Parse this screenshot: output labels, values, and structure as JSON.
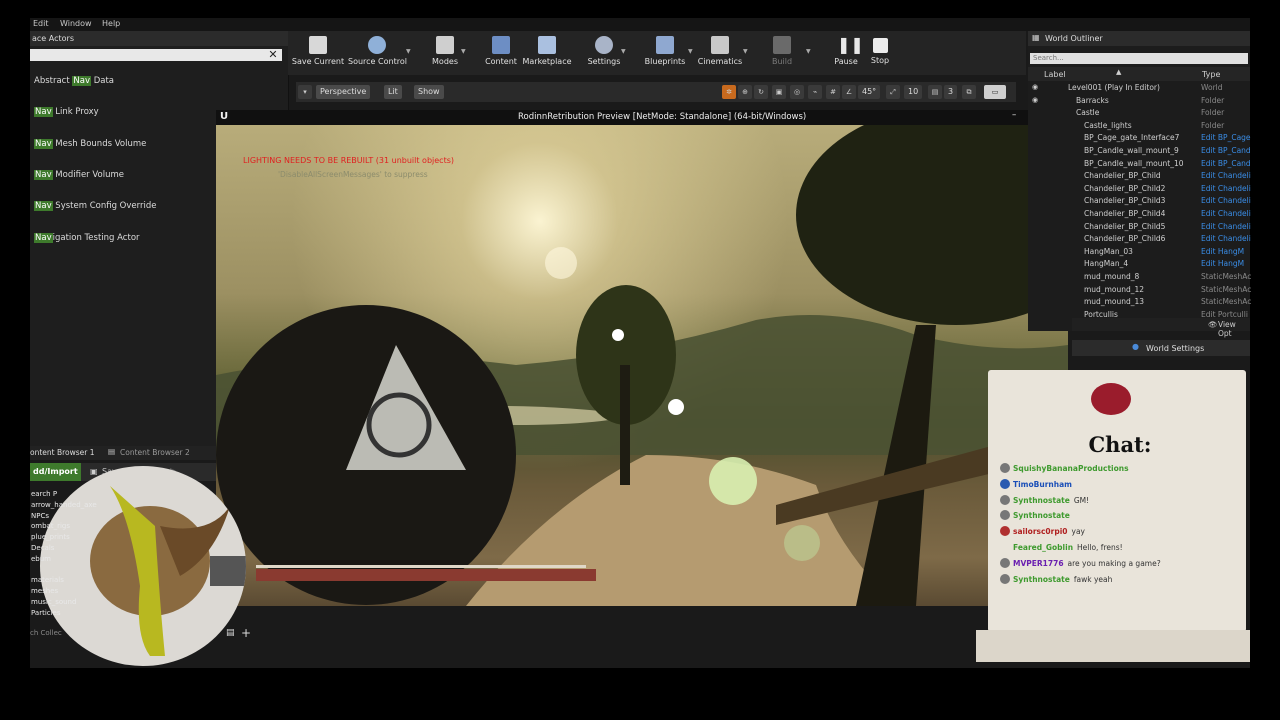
{
  "menu": {
    "edit": "Edit",
    "window": "Window",
    "help": "Help"
  },
  "left_panel": {
    "tab_label": "ace Actors",
    "items": [
      {
        "hl": "",
        "pre": "Abstract ",
        "mark": "Nav",
        "post": " Data"
      },
      {
        "pre": "",
        "mark": "Nav",
        "post": " Link Proxy"
      },
      {
        "pre": "",
        "mark": "Nav",
        "post": " Mesh Bounds Volume"
      },
      {
        "pre": "",
        "mark": "Nav",
        "post": " Modifier Volume"
      },
      {
        "pre": "",
        "mark": "Nav",
        "post": " System Config Override"
      },
      {
        "pre": "",
        "mark": "Nav",
        "post": "igation Testing Actor"
      }
    ]
  },
  "toolbar": {
    "save_current": "Save Current",
    "source_control": "Source Control",
    "modes": "Modes",
    "content": "Content",
    "marketplace": "Marketplace",
    "settings": "Settings",
    "blueprints": "Blueprints",
    "cinematics": "Cinematics",
    "build": "Build",
    "pause": "Pause",
    "stop": "Stop"
  },
  "viewport_bar": {
    "perspective": "Perspective",
    "lit": "Lit",
    "show": "Show",
    "angle": "45°",
    "grid": "10",
    "cam": "3"
  },
  "game": {
    "title": "RodinnRetribution Preview [NetMode: Standalone] (64-bit/Windows)",
    "warning": "LIGHTING NEEDS TO BE REBUILT (31 unbuilt objects)",
    "suppress": "'DisableAllScreenMessages' to suppress"
  },
  "outliner": {
    "tab": "World Outliner",
    "search_placeholder": "Search...",
    "col_label": "Label",
    "col_type": "Type",
    "rows": [
      {
        "label": "Level001 (Play In Editor)",
        "type": "World",
        "indent": 40,
        "kind": "gray"
      },
      {
        "label": "Barracks",
        "type": "Folder",
        "indent": 48,
        "kind": "gray"
      },
      {
        "label": "Castle",
        "type": "Folder",
        "indent": 48,
        "kind": "gray"
      },
      {
        "label": "Castle_lights",
        "type": "Folder",
        "indent": 56,
        "kind": "gray"
      },
      {
        "label": "BP_Cage_gate_Interface7",
        "type": "Edit BP_Cage",
        "indent": 56,
        "kind": "edit"
      },
      {
        "label": "BP_Candle_wall_mount_9",
        "type": "Edit BP_Cand",
        "indent": 56,
        "kind": "edit"
      },
      {
        "label": "BP_Candle_wall_mount_10",
        "type": "Edit BP_Cand",
        "indent": 56,
        "kind": "edit"
      },
      {
        "label": "Chandelier_BP_Child",
        "type": "Edit Chandeli",
        "indent": 56,
        "kind": "edit"
      },
      {
        "label": "Chandelier_BP_Child2",
        "type": "Edit Chandeli",
        "indent": 56,
        "kind": "edit"
      },
      {
        "label": "Chandelier_BP_Child3",
        "type": "Edit Chandeli",
        "indent": 56,
        "kind": "edit"
      },
      {
        "label": "Chandelier_BP_Child4",
        "type": "Edit Chandeli",
        "indent": 56,
        "kind": "edit"
      },
      {
        "label": "Chandelier_BP_Child5",
        "type": "Edit Chandeli",
        "indent": 56,
        "kind": "edit"
      },
      {
        "label": "Chandelier_BP_Child6",
        "type": "Edit Chandeli",
        "indent": 56,
        "kind": "edit"
      },
      {
        "label": "HangMan_03",
        "type": "Edit HangM",
        "indent": 56,
        "kind": "edit"
      },
      {
        "label": "HangMan_4",
        "type": "Edit HangM",
        "indent": 56,
        "kind": "edit"
      },
      {
        "label": "mud_mound_8",
        "type": "StaticMeshAc",
        "indent": 56,
        "kind": "gray"
      },
      {
        "label": "mud_mound_12",
        "type": "StaticMeshAc",
        "indent": 56,
        "kind": "gray"
      },
      {
        "label": "mud_mound_13",
        "type": "StaticMeshAc",
        "indent": 56,
        "kind": "gray"
      },
      {
        "label": "Portcullis",
        "type": "Edit Portculli",
        "indent": 56,
        "kind": "gray"
      }
    ],
    "view_options": "View Opt",
    "world_settings": "World Settings"
  },
  "content_browser": {
    "tab1": "ontent Browser 1",
    "tab2": "Content Browser 2",
    "add_import": "dd/Import",
    "save_all": "Save All",
    "folders": [
      "earch P",
      "arrow_handed_axe",
      "NPCs",
      "ombat_rigs",
      "plue_prints",
      "Decals",
      "ebum",
      "",
      "materials",
      "meshes",
      "music_sound",
      "Particles"
    ],
    "collections": "ch Collec"
  },
  "chat": {
    "title": "Chat:",
    "messages": [
      {
        "name": "SquishyBananaProductions",
        "msg": "",
        "color": "#3e9a2e",
        "dot": "#777"
      },
      {
        "name": "TimoBurnham",
        "msg": "",
        "color": "#1a4fb8",
        "dot": "#2a5ab0"
      },
      {
        "name": "Synthnostate",
        "msg": "GM!",
        "color": "#3e9a2e",
        "dot": "#777"
      },
      {
        "name": "Synthnostate",
        "msg": "",
        "color": "#3e9a2e",
        "dot": "#777"
      },
      {
        "name": "sailorsc0rpi0",
        "msg": "yay",
        "color": "#b02020",
        "dot": "#b03030"
      },
      {
        "name": "Feared_Goblin",
        "msg": "Hello, frens!",
        "color": "#3e9a2e",
        "dot": ""
      },
      {
        "name": "MVPER1776",
        "msg": "are you making a game?",
        "color": "#6a1fb0",
        "dot": "#777"
      },
      {
        "name": "Synthnostate",
        "msg": "fawk yeah",
        "color": "#3e9a2e",
        "dot": "#777"
      }
    ]
  },
  "colors": {
    "nav_highlight": "#3e7a2c",
    "edit_link": "#3a8de6",
    "warning": "#e02020"
  }
}
